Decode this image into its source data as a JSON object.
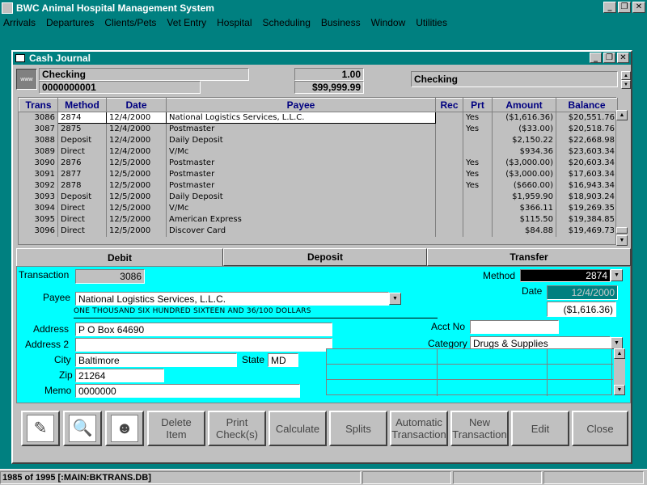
{
  "app": {
    "title": "BWC Animal Hospital Management System"
  },
  "window_controls": {
    "minimize": "_",
    "restore": "❐",
    "close": "✕"
  },
  "menu": [
    "Arrivals",
    "Departures",
    "Clients/Pets",
    "Vet Entry",
    "Hospital",
    "Scheduling",
    "Business",
    "Window",
    "Utilities"
  ],
  "journal": {
    "title": "Cash Journal",
    "account_icon": "www",
    "account_name": "Checking",
    "account_number": "0000000001",
    "rate": "1.00",
    "balance": "$99,999.99",
    "account_selector": "Checking"
  },
  "grid": {
    "headers": [
      "Trans",
      "Method",
      "Date",
      "Payee",
      "Rec",
      "Prt",
      "Amount",
      "Balance"
    ],
    "rows": [
      [
        "3086",
        "2874",
        "12/4/2000",
        "National Logistics Services, L.L.C.",
        "",
        "Yes",
        "($1,616.36)",
        "$20,551.76"
      ],
      [
        "3087",
        "2875",
        "12/4/2000",
        "Postmaster",
        "",
        "Yes",
        "($33.00)",
        "$20,518.76"
      ],
      [
        "3088",
        "Deposit",
        "12/4/2000",
        "Daily Deposit",
        "",
        "",
        "$2,150.22",
        "$22,668.98"
      ],
      [
        "3089",
        "Direct",
        "12/4/2000",
        "V/Mc",
        "",
        "",
        "$934.36",
        "$23,603.34"
      ],
      [
        "3090",
        "2876",
        "12/5/2000",
        "Postmaster",
        "",
        "Yes",
        "($3,000.00)",
        "$20,603.34"
      ],
      [
        "3091",
        "2877",
        "12/5/2000",
        "Postmaster",
        "",
        "Yes",
        "($3,000.00)",
        "$17,603.34"
      ],
      [
        "3092",
        "2878",
        "12/5/2000",
        "Postmaster",
        "",
        "Yes",
        "($660.00)",
        "$16,943.34"
      ],
      [
        "3093",
        "Deposit",
        "12/5/2000",
        "Daily Deposit",
        "",
        "",
        "$1,959.90",
        "$18,903.24"
      ],
      [
        "3094",
        "Direct",
        "12/5/2000",
        "V/Mc",
        "",
        "",
        "$366.11",
        "$19,269.35"
      ],
      [
        "3095",
        "Direct",
        "12/5/2000",
        "American Express",
        "",
        "",
        "$115.50",
        "$19,384.85"
      ],
      [
        "3096",
        "Direct",
        "12/5/2000",
        "Discover Card",
        "",
        "",
        "$84.88",
        "$19,469.73"
      ]
    ],
    "selected_index": 0
  },
  "tabs": [
    "Debit",
    "Deposit",
    "Transfer"
  ],
  "form": {
    "transaction_label": "Transaction",
    "transaction_value": "3086",
    "method_label": "Method",
    "method_value": "2874",
    "date_label": "Date",
    "date_value": "12/4/2000",
    "amount_value": "($1,616.36)",
    "payee_label": "Payee",
    "payee_value": "National Logistics Services, L.L.C.",
    "amount_words": "ONE THOUSAND SIX HUNDRED SIXTEEN AND 36/100 DOLLARS",
    "address_label": "Address",
    "address_value": "P O Box 64690",
    "address2_label": "Address 2",
    "address2_value": "",
    "acctno_label": "Acct No",
    "acctno_value": "",
    "category_label": "Category",
    "category_value": "Drugs & Supplies",
    "city_label": "City",
    "city_value": "Baltimore",
    "state_label": "State",
    "state_value": "MD",
    "zip_label": "Zip",
    "zip_value": "21264",
    "memo_label": "Memo",
    "memo_value": "0000000"
  },
  "toolbar": {
    "icon_buttons": [
      "pen-icon",
      "search-person-icon",
      "person-icon"
    ],
    "buttons": [
      "Delete\nItem",
      "Print\nCheck(s)",
      "Calculate",
      "Splits",
      "Automatic\nTransaction",
      "New\nTransaction",
      "Edit",
      "Close"
    ]
  },
  "status": {
    "text": "1985 of 1995 [:MAIN:BKTRANS.DB]"
  }
}
